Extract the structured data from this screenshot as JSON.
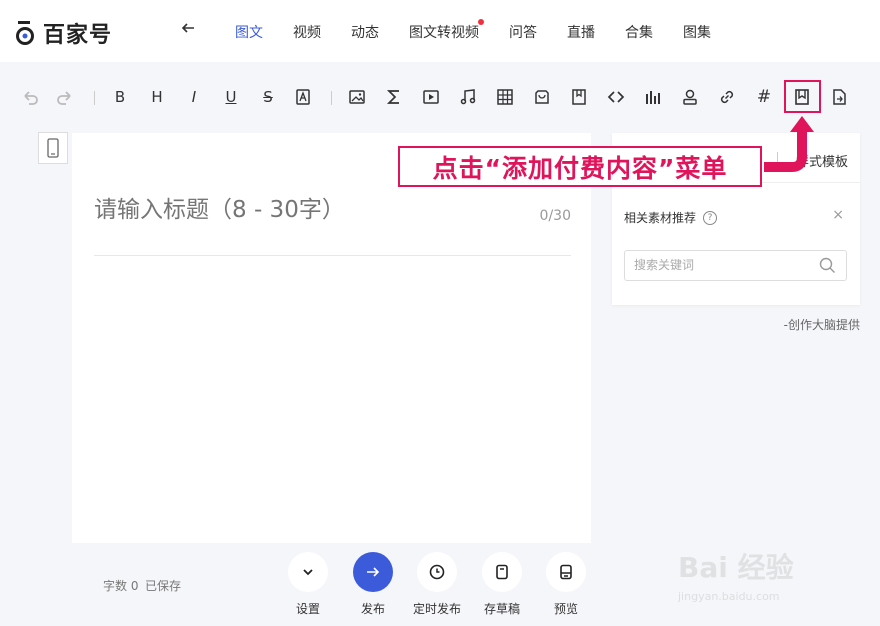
{
  "brand": {
    "name": "百家号",
    "accent": "#3b5bdb",
    "annotation_color": "#e0145a"
  },
  "nav": {
    "back_icon": "arrow-left-icon",
    "tabs": [
      {
        "label": "图文",
        "active": true
      },
      {
        "label": "视频"
      },
      {
        "label": "动态"
      },
      {
        "label": "图文转视频",
        "dot": true
      },
      {
        "label": "问答"
      },
      {
        "label": "直播"
      },
      {
        "label": "合集"
      },
      {
        "label": "图集"
      }
    ]
  },
  "toolbar": {
    "bold": "B",
    "heading": "H",
    "italic": "I",
    "underline": "U",
    "strike": "S",
    "hash": "#",
    "items": [
      "undo-icon",
      "redo-icon",
      "bold-icon",
      "heading-icon",
      "italic-icon",
      "underline-icon",
      "strikethrough-icon",
      "format-clear-icon",
      "image-icon",
      "formula-icon",
      "video-icon",
      "music-icon",
      "table-icon",
      "shop-icon",
      "book-icon",
      "code-icon",
      "chart-icon",
      "user-icon",
      "link-icon",
      "topic-hash-icon",
      "paid-content-bookmark-icon",
      "document-icon"
    ]
  },
  "editor": {
    "title_placeholder": "请输入标题（8 - 30字）",
    "title_count": "0/30"
  },
  "panel": {
    "style_tab": "样式模板",
    "subtitle": "相关素材推荐",
    "help": "?",
    "close": "×",
    "search_placeholder": "搜索关键词",
    "footnote": "-创作大脑提供"
  },
  "annotation": {
    "text": "点击“添加付费内容”菜单"
  },
  "bottom": {
    "word_count": "字数 0",
    "save_state": "已保存",
    "actions": [
      {
        "label": "设置",
        "icon": "chevron-down-icon"
      },
      {
        "label": "发布",
        "icon": "arrow-right-icon",
        "primary": true
      },
      {
        "label": "定时发布",
        "icon": "clock-icon"
      },
      {
        "label": "存草稿",
        "icon": "draft-icon"
      },
      {
        "label": "预览",
        "icon": "preview-icon"
      }
    ]
  },
  "watermark": {
    "text": "Bai 经验",
    "sub": "jingyan.baidu.com"
  }
}
